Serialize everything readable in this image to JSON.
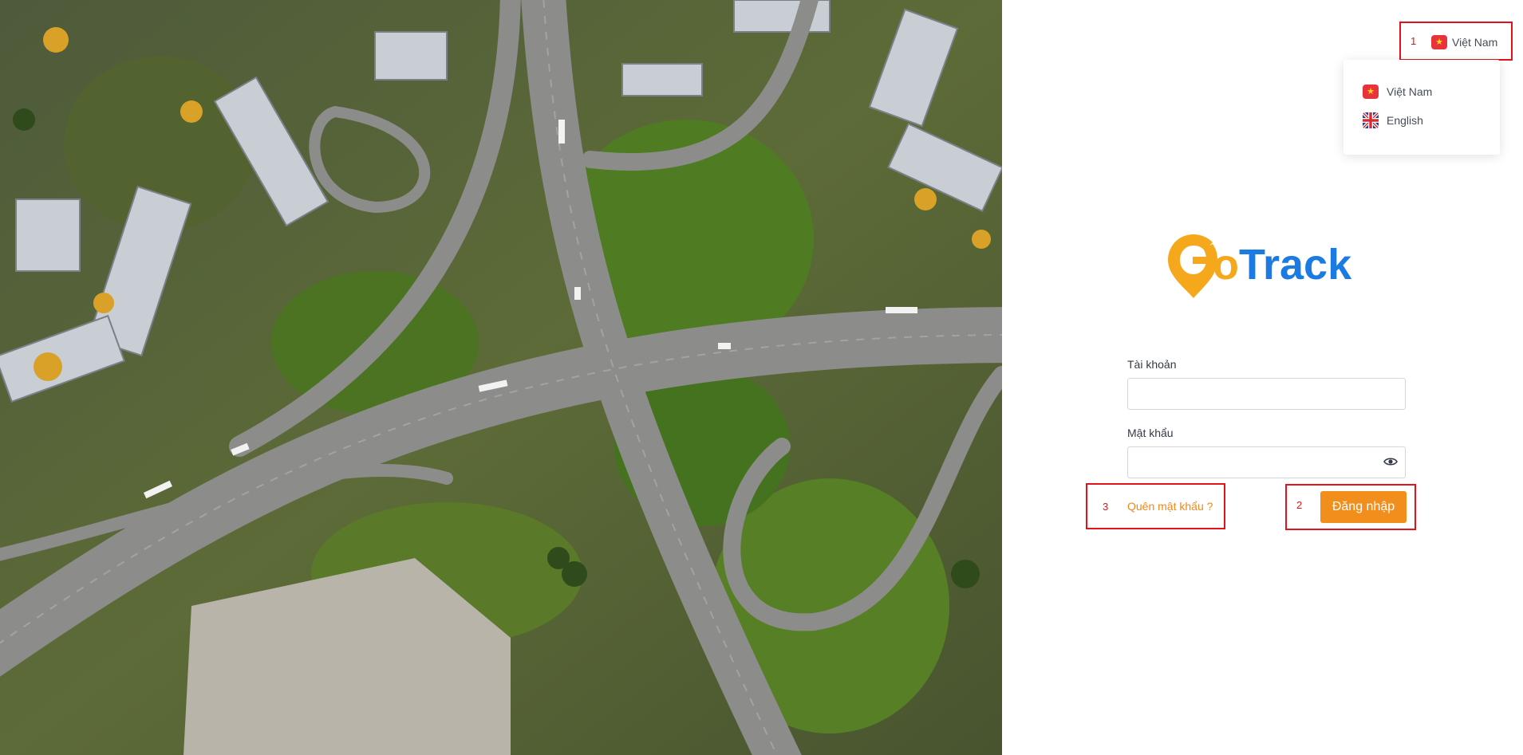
{
  "language": {
    "current_label": "Việt Nam",
    "options": [
      {
        "label": "Việt Nam",
        "flag": "vietnam-flag-icon"
      },
      {
        "label": "English",
        "flag": "uk-flag-icon"
      }
    ]
  },
  "brand": {
    "logo_text_g": "G",
    "logo_text_rest": "oTrack",
    "colors": {
      "orange": "#f5a81c",
      "blue": "#1b7be3"
    }
  },
  "form": {
    "username_label": "Tài khoản",
    "username_value": "",
    "password_label": "Mật khẩu",
    "password_value": "",
    "forgot_label": "Quên mật khẩu ?",
    "login_label": "Đăng nhập"
  },
  "annotations": {
    "marker_1": "1",
    "marker_2": "2",
    "marker_3": "3"
  },
  "colors": {
    "accent": "#f28e1c",
    "annotation_red": "#e0131b",
    "text": "#333a44"
  }
}
